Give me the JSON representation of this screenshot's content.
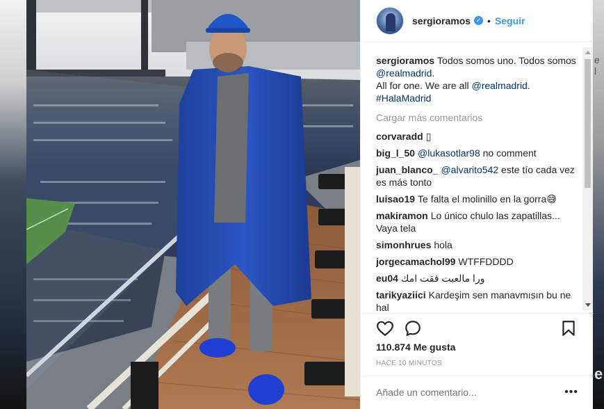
{
  "header": {
    "username": "sergioramos",
    "separator": "•",
    "follow_label": "Seguir",
    "verified_symbol": "✓"
  },
  "caption": {
    "username": "sergioramos",
    "line1": "Todos somos uno. Todos somos ",
    "mention1": "@realmadrid",
    "line1_end": ".",
    "line2": "All for one. We are all ",
    "mention2": "@realmadrid",
    "line2_end": ".",
    "hashtag": "#HalaMadrid"
  },
  "load_more_label": "Cargar más comentarios",
  "comments": [
    {
      "user": "corvaradd",
      "mention": "",
      "text": "▯"
    },
    {
      "user": "big_l_50",
      "mention": "@lukasotlar98",
      "text": " no comment"
    },
    {
      "user": "juan_blanco_",
      "mention": "@alvarito542",
      "text": " este tío cada vez es más tonto"
    },
    {
      "user": "luisao19",
      "mention": "",
      "text": "Te falta el molinillo en la gorra😅"
    },
    {
      "user": "makiramon",
      "mention": "",
      "text": "Lo único chulo las zapatillas... Vaya tela"
    },
    {
      "user": "simonhrues",
      "mention": "",
      "text": "hola"
    },
    {
      "user": "jorgecamachol99",
      "mention": "",
      "text": "WTFFDDDD"
    },
    {
      "user": "eu04",
      "mention": "",
      "text": "ورا مالعبت فقت امك"
    },
    {
      "user": "tarikyaziici",
      "mention": "",
      "text": "Kardeşim sen manavmısın bu ne hal"
    }
  ],
  "likes_label": "110.874 Me gusta",
  "timestamp": "HACE 10 MINUTOS",
  "comment_placeholder": "Añade un comentario...",
  "more_options": "•••",
  "backdrop_edge": {
    "top_char": "e l",
    "bottom_char": "e"
  },
  "icons": {
    "like": "heart-outline-icon",
    "comment": "speech-bubble-icon",
    "save": "bookmark-icon",
    "verified": "verified-badge-icon"
  },
  "colors": {
    "link": "#003569",
    "follow": "#3897f0",
    "muted": "#999999",
    "text": "#262626",
    "coat": "#2b4fb0"
  }
}
